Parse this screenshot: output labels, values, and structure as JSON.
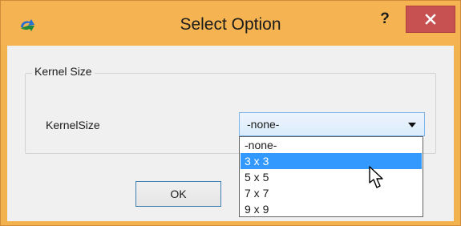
{
  "window": {
    "title": "Select Option",
    "help_label": "?",
    "close_label": "close"
  },
  "group": {
    "title": "Kernel Size",
    "field_label": "KernelSize"
  },
  "combo": {
    "selected": "-none-",
    "options": [
      "-none-",
      "3 x 3",
      "5 x 5",
      "7 x 7",
      "9 x 9"
    ],
    "highlighted_option": "3 x 3"
  },
  "buttons": {
    "ok_label": "OK"
  },
  "colors": {
    "titlebar": "#f5b451",
    "close_button": "#c75050",
    "highlight": "#3399ff",
    "combo_border": "#7eb4ea"
  },
  "icons": {
    "app": "app-icon",
    "close": "close-icon",
    "dropdown": "chevron-down-icon",
    "cursor": "mouse-pointer-icon"
  }
}
